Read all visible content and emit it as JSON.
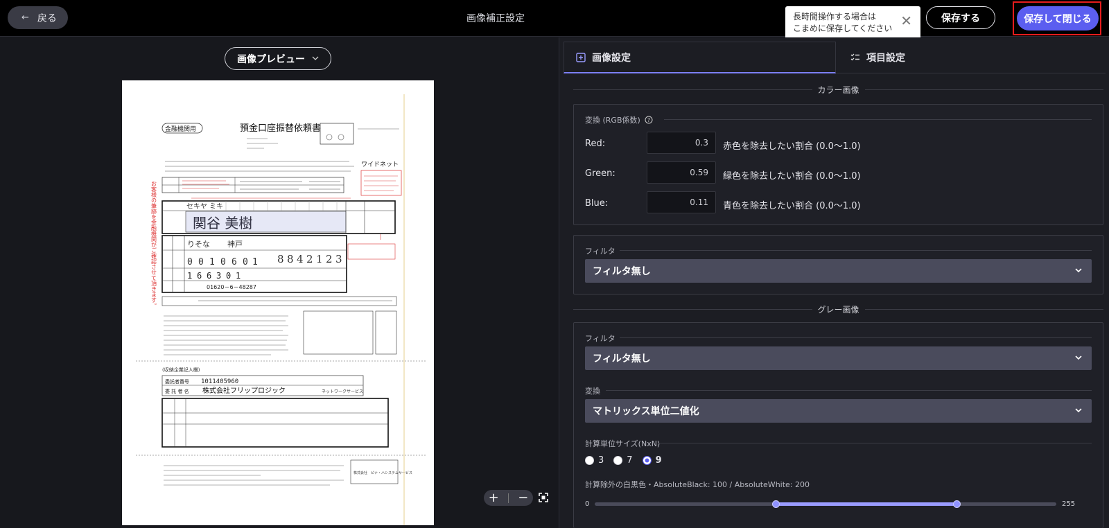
{
  "header": {
    "back_label": "戻る",
    "title": "画像補正設定",
    "tooltip_line1": "長時間操作する場合は",
    "tooltip_line2": "こまめに保存してください",
    "save_label": "保存する",
    "save_close_label": "保存して閉じる"
  },
  "preview": {
    "select_label": "画像プレビュー",
    "doc": {
      "bank_label": "金融機関用",
      "doc_title": "預金口座振替依頼書",
      "widenet": "ワイドネット",
      "name_hand": "関谷 美樹",
      "kana_hand": "セキヤ ミキ",
      "bank_hand": "りそな",
      "branch_hand": "神戸",
      "code_digits": [
        "0",
        "0",
        "1",
        "0"
      ],
      "branch_code_digits": [
        "6",
        "0",
        "1"
      ],
      "account_digits": [
        "8",
        "8",
        "4",
        "2",
        "1",
        "2",
        "3"
      ],
      "furikae_digits": [
        "1",
        "6",
        "6",
        "3",
        "0",
        "1"
      ],
      "furikae_code": "01620－6－48287",
      "consignor_no_label": "委託者番号",
      "consignor_no": "1011405960",
      "company_label": "委 託 者 名",
      "company_name": "株式会社フリップロジック",
      "service": "ネットワークサービス",
      "consignor_header": "(収納企業記入欄)",
      "side_note": "お客様の筆跡を金融機関がご確認させて頂きます。",
      "footer_company": "株式会社　ピナ・ハシステムサービス"
    }
  },
  "tabs": {
    "image_settings": "画像設定",
    "item_settings": "項目設定"
  },
  "color_section": {
    "title": "カラー画像",
    "convert_label": "変換 (RGB係数)",
    "rows": [
      {
        "label": "Red:",
        "value": "0.3",
        "desc": "赤色を除去したい割合 (0.0〜1.0)"
      },
      {
        "label": "Green:",
        "value": "0.59",
        "desc": "緑色を除去したい割合 (0.0〜1.0)"
      },
      {
        "label": "Blue:",
        "value": "0.11",
        "desc": "青色を除去したい割合 (0.0〜1.0)"
      }
    ],
    "filter_label": "フィルタ",
    "filter_value": "フィルタ無し"
  },
  "gray_section": {
    "title": "グレー画像",
    "filter_label": "フィルタ",
    "filter_value": "フィルタ無し",
    "convert_label": "変換",
    "convert_value": "マトリックス単位二値化",
    "unit_size_label": "計算単位サイズ(NxN)",
    "unit_options": [
      "3",
      "7",
      "9"
    ],
    "unit_selected": "9",
    "exclude_label": "計算除外の白黒色・AbsoluteBlack: 100 / AbsoluteWhite: 200",
    "slider_min": "0",
    "slider_max": "255",
    "absolute_black": 100,
    "absolute_white": 200
  },
  "colors": {
    "accent": "#5b5ef0",
    "highlight_border": "#e51c1c",
    "tab_underline": "#7c7ff5"
  }
}
